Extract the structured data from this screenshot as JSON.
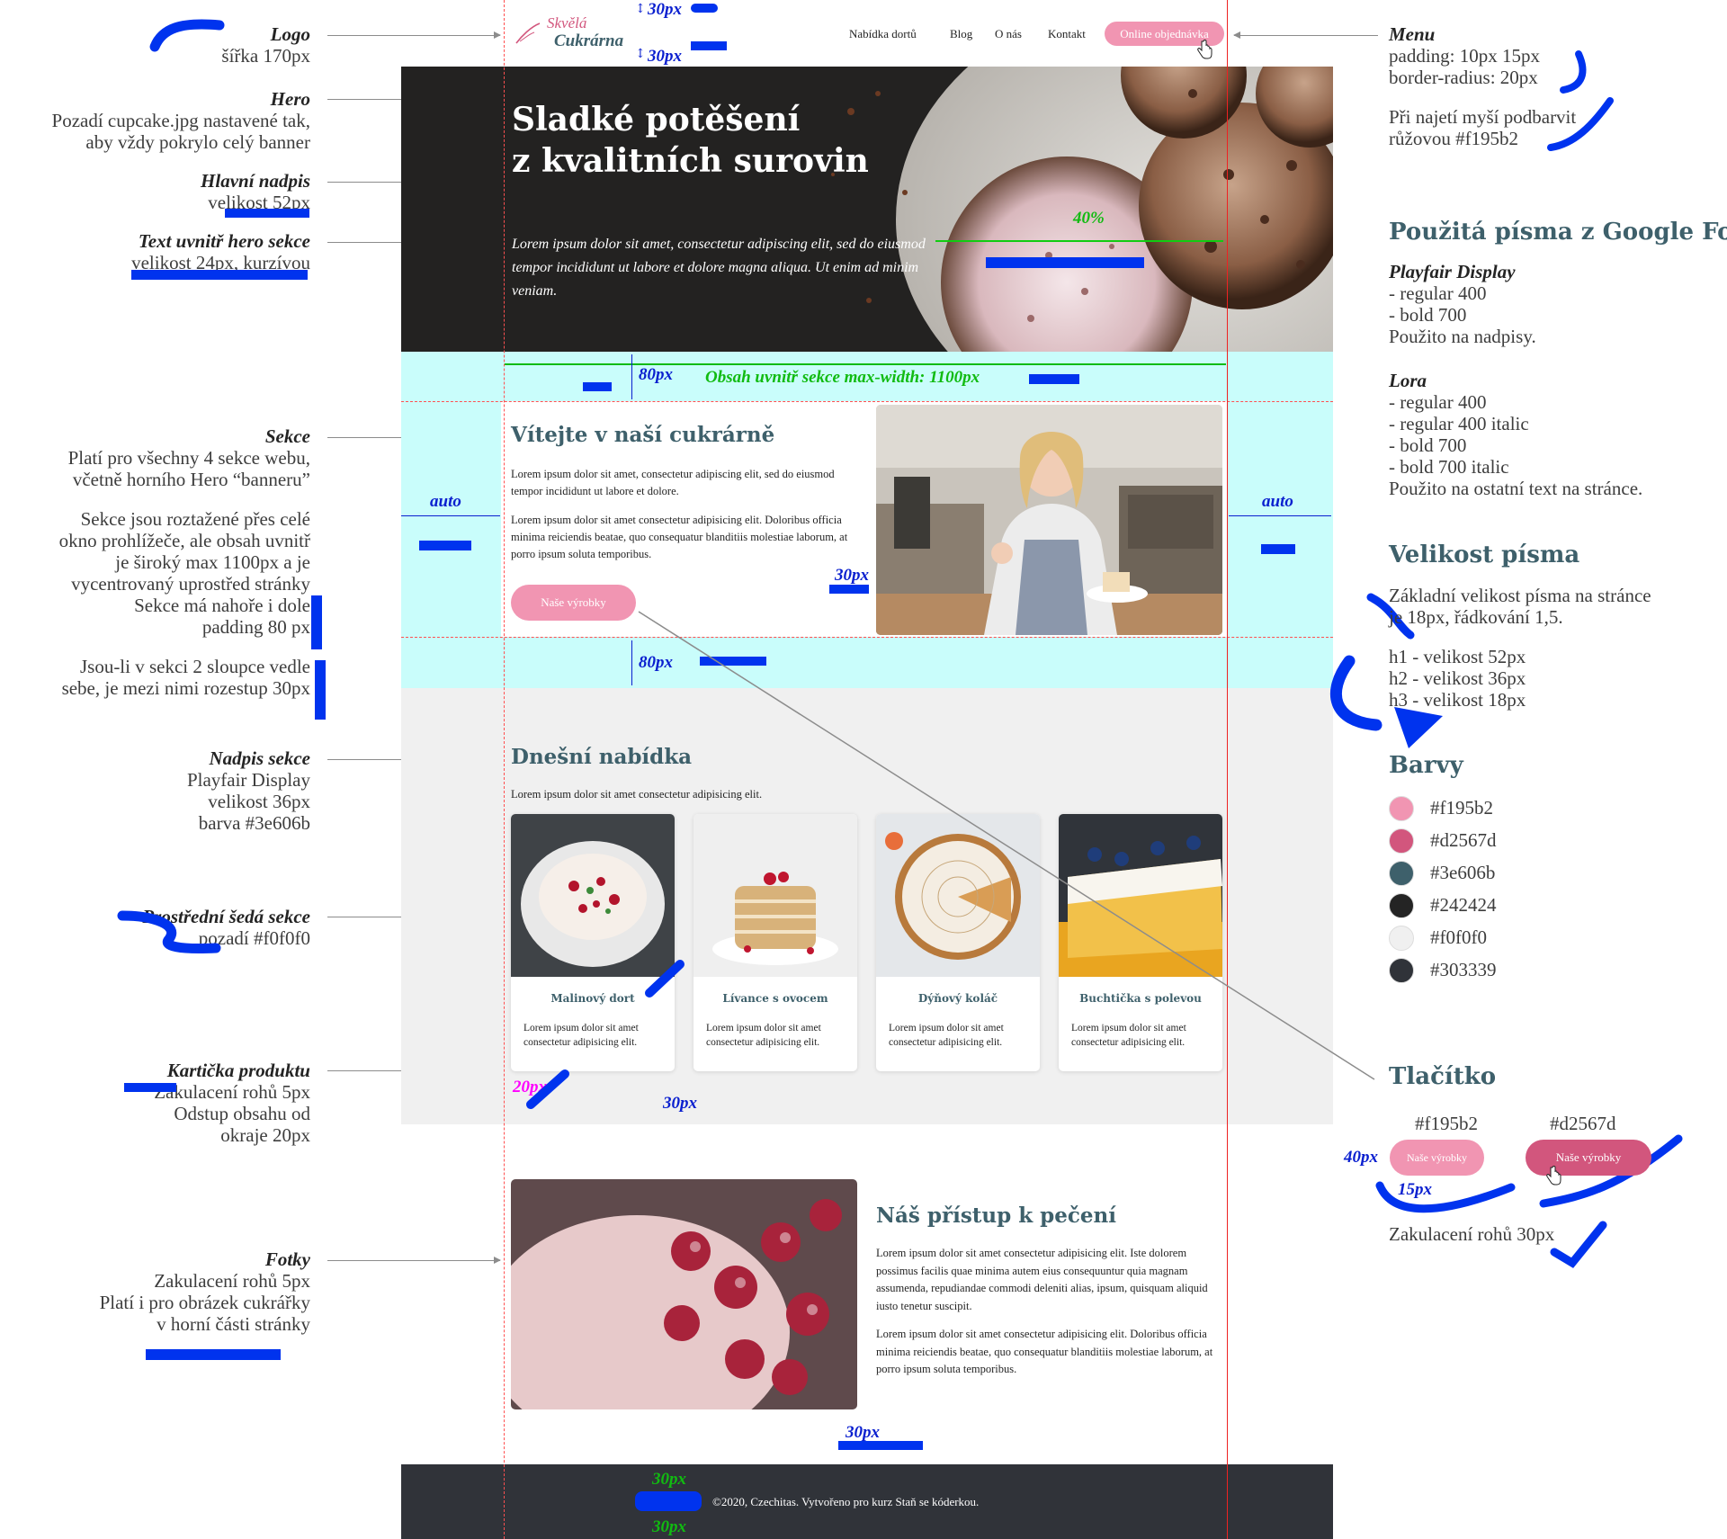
{
  "annotations_left": {
    "logo": {
      "title": "Logo",
      "lines": [
        "šířka 170px"
      ]
    },
    "hero": {
      "title": "Hero",
      "lines": [
        "Pozadí cupcake.jpg nastavené tak,",
        "aby vždy pokrylo celý banner"
      ]
    },
    "main_heading": {
      "title": "Hlavní nadpis",
      "lines": [
        "velikost 52px"
      ]
    },
    "hero_text": {
      "title": "Text uvnitř hero sekce",
      "lines": [
        "velikost 24px, kurzívou"
      ]
    },
    "section": {
      "title": "Sekce",
      "lines": [
        "Platí pro všechny 4 sekce webu,",
        "včetně horního Hero “banneru”",
        "",
        "Sekce jsou roztažené přes celé",
        "okno prohlížeče, ale obsah uvnitř",
        "je široký max 1100px a je",
        "vycentrovaný uprostřed stránky",
        "Sekce má nahoře i dole",
        "padding 80 px",
        "",
        "Jsou-li v sekci 2 sloupce vedle",
        "sebe, je mezi nimi rozestup 30px"
      ]
    },
    "section_heading": {
      "title": "Nadpis sekce",
      "lines": [
        "Playfair Display",
        "velikost 36px",
        "barva #3e606b"
      ]
    },
    "grey_section": {
      "title": "Prostřední šedá sekce",
      "lines": [
        "pozadí #f0f0f0"
      ]
    },
    "product_card": {
      "title": "Kartička produktu",
      "lines": [
        "Zakulacení rohů 5px",
        "Odstup obsahu od",
        "okraje 20px"
      ]
    },
    "photos": {
      "title": "Fotky",
      "lines": [
        "Zakulacení rohů 5px",
        "Platí i pro obrázek cukrářky",
        "v horní části stránky"
      ]
    }
  },
  "annotations_right": {
    "menu": {
      "title": "Menu",
      "lines": [
        "padding: 10px 15px",
        "border-radius: 20px",
        "",
        "Při najetí myší podbarvit",
        "růžovou #f195b2"
      ]
    },
    "fonts_heading": "Použitá písma z Google Fonts",
    "font1": {
      "title": "Playfair Display",
      "lines": [
        "- regular 400",
        "- bold 700",
        "Použito na nadpisy."
      ]
    },
    "font2": {
      "title": "Lora",
      "lines": [
        "- regular 400",
        "- regular 400 italic",
        "- bold 700",
        "- bold 700 italic",
        "Použito na ostatní text na stránce."
      ]
    },
    "size_heading": "Velikost písma",
    "size_lines": [
      "Základní velikost písma na stránce",
      "je 18px, řádkování 1,5.",
      "",
      "h1 - velikost 52px",
      "h2 - velikost 36px",
      "h3 - velikost 18px"
    ],
    "colors_heading": "Barvy",
    "colors": [
      "#f195b2",
      "#d2567d",
      "#3e606b",
      "#242424",
      "#f0f0f0",
      "#303339"
    ],
    "button_heading": "Tlačítko",
    "button_color_a": "#f195b2",
    "button_color_b": "#d2567d",
    "button_label": "Naše výrobky",
    "button_radius": "Zakulacení rohů 30px"
  },
  "measures": {
    "px30": "30px",
    "px40": "40px",
    "px15": "15px",
    "px20": "20px",
    "px80": "80px",
    "auto": "auto",
    "pct40": "40%",
    "maxwidth": "Obsah uvnitř sekce max-width: 1100px"
  },
  "site": {
    "logo_line1": "Skvělá",
    "logo_line2": "Cukrárna",
    "nav": [
      "Nabídka dortů",
      "Blog",
      "O nás",
      "Kontakt"
    ],
    "nav_cta": "Online objednávka",
    "hero_title_1": "Sladké potěšení",
    "hero_title_2": "z kvalitních surovin",
    "hero_text": "Lorem ipsum dolor sit amet, consectetur adipiscing elit, sed do eiusmod tempor incididunt ut labore et dolore magna aliqua. Ut enim ad minim veniam.",
    "welcome_title": "Vítejte v naší cukrárně",
    "welcome_p1": "Lorem ipsum dolor sit amet, consectetur adipiscing elit, sed do eiusmod tempor incididunt ut labore et dolore.",
    "welcome_p2": "Lorem ipsum dolor sit amet consectetur adipisicing elit. Doloribus officia minima reiciendis beatae, quo consequatur blanditiis molestiae laborum, at porro ipsum soluta temporibus.",
    "welcome_button": "Naše výrobky",
    "offer_title": "Dnešní nabídka",
    "offer_text": "Lorem ipsum dolor sit amet consectetur adipisicing elit.",
    "cards": [
      {
        "title": "Malinový dort",
        "text": "Lorem ipsum dolor sit amet consectetur adipisicing elit."
      },
      {
        "title": "Lívance s ovocem",
        "text": "Lorem ipsum dolor sit amet consectetur adipisicing elit."
      },
      {
        "title": "Dýňový koláč",
        "text": "Lorem ipsum dolor sit amet consectetur adipisicing elit."
      },
      {
        "title": "Buchtička s polevou",
        "text": "Lorem ipsum dolor sit amet consectetur adipisicing elit."
      }
    ],
    "approach_title": "Náš přístup k pečení",
    "approach_p1": "Lorem ipsum dolor sit amet consectetur adipisicing elit. Iste dolorem possimus facilis quae minima autem eius consequuntur quia magnam assumenda, repudiandae commodi deleniti alias, ipsum, quisquam aliquid iusto tenetur suscipit.",
    "approach_p2": "Lorem ipsum dolor sit amet consectetur adipisicing elit. Doloribus officia minima reiciendis beatae, quo consequatur blanditiis molestiae laborum, at porro ipsum soluta temporibus.",
    "footer": "©2020, Czechitas. Vytvořeno pro kurz Staň se kóderkou."
  }
}
